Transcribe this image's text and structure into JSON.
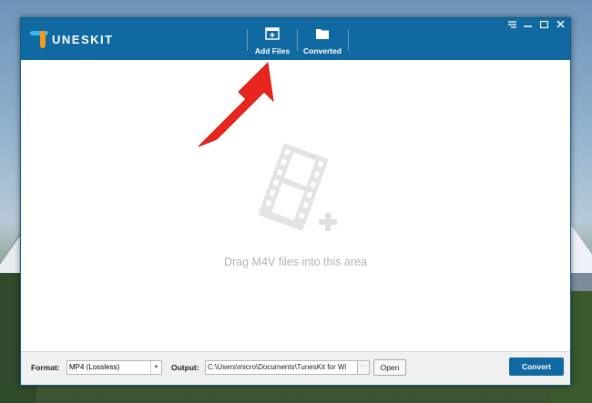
{
  "app": {
    "logo_text": "UNESKIT"
  },
  "toolbar": {
    "add_files_label": "Add Files",
    "converted_label": "Converted"
  },
  "window_controls": {
    "menu_icon": "menu-icon",
    "minimize_icon": "minimize-icon",
    "maximize_icon": "maximize-icon",
    "close_icon": "close-icon"
  },
  "droparea": {
    "hint": "Drag M4V files into this area",
    "icon": "film-add-icon"
  },
  "bottombar": {
    "format_label": "Format:",
    "format_value": "MP4 (Lossless)",
    "output_label": "Output:",
    "output_path": "C:\\Users\\micro\\Documents\\TunesKit for Wi",
    "browse_label": "···",
    "open_label": "Open",
    "convert_label": "Convert"
  },
  "colors": {
    "accent": "#106aa1",
    "annotation_arrow": "#e8261e"
  }
}
